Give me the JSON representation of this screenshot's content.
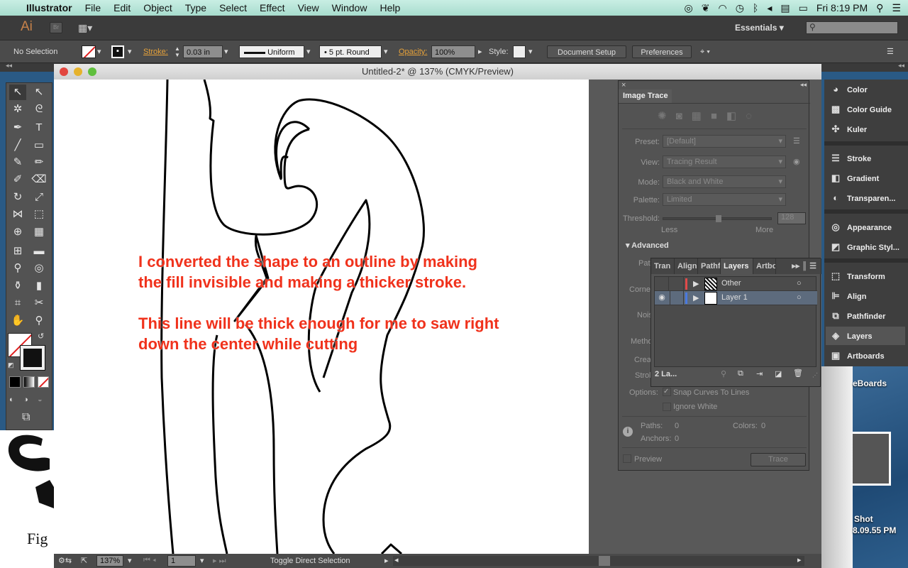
{
  "menubar": {
    "app": "Illustrator",
    "items": [
      "File",
      "Edit",
      "Object",
      "Type",
      "Select",
      "Effect",
      "View",
      "Window",
      "Help"
    ],
    "clock": "Fri 8:19 PM"
  },
  "appbar": {
    "logo": "Ai",
    "bridge": "Br",
    "workspace": "Essentials",
    "search_placeholder": ""
  },
  "control": {
    "selection": "No Selection",
    "stroke_label": "Stroke:",
    "stroke_value": "0.03 in",
    "profile": "Uniform",
    "brush": "5 pt. Round",
    "opacity_label": "Opacity:",
    "opacity_value": "100%",
    "style_label": "Style:",
    "document_setup": "Document Setup",
    "preferences": "Preferences"
  },
  "document": {
    "title": "Untitled-2* @ 137% (CMYK/Preview)",
    "zoom": "137%",
    "artboard": "1",
    "status": "Toggle Direct Selection"
  },
  "annotation": {
    "line1": "I converted the shape to an outline by making",
    "line2": "the fill invisible and making a thicker stroke.",
    "line3": "This line will be thick enough for me to saw right",
    "line4": "down the center while cutting"
  },
  "image_trace": {
    "title": "Image Trace",
    "preset_label": "Preset:",
    "preset": "[Default]",
    "view_label": "View:",
    "view": "Tracing Result",
    "mode_label": "Mode:",
    "mode": "Black and White",
    "palette_label": "Palette:",
    "palette": "Limited",
    "threshold_label": "Threshold:",
    "threshold": "128",
    "less": "Less",
    "more": "More",
    "advanced": "Advanced",
    "paths_cut": "Path",
    "corners_cut": "Corne",
    "noise_cut": "Nois",
    "method_cut": "Metho",
    "create_cut": "Crea",
    "stroke_cut": "Strol",
    "options_label": "Options:",
    "snap": "Snap Curves To Lines",
    "snap_checked": true,
    "ignore_white": "Ignore White",
    "ignore_white_checked": false,
    "paths_stat": "Paths:",
    "paths_val": "0",
    "colors_stat": "Colors:",
    "colors_val": "0",
    "anchors_stat": "Anchors:",
    "anchors_val": "0",
    "preview": "Preview",
    "trace_button": "Trace"
  },
  "layers_panel": {
    "tabs": [
      "Tran",
      "Align",
      "Pathf",
      "Layers",
      "Artbo"
    ],
    "active_tab": "Layers",
    "layers": [
      {
        "name": "Other",
        "color": "#e04a4a",
        "visible": false
      },
      {
        "name": "Layer 1",
        "color": "#4a7ae0",
        "visible": true,
        "selected": true
      }
    ],
    "count": "2 La..."
  },
  "dock": {
    "items": [
      "Color",
      "Color Guide",
      "Kuler",
      "Stroke",
      "Gradient",
      "Transparen...",
      "Appearance",
      "Graphic Styl...",
      "Transform",
      "Align",
      "Pathfinder",
      "Layers",
      "Artboards"
    ]
  },
  "desktop": {
    "label1": "eBoards",
    "label2": "Shot",
    "label3": "8.09.55 PM",
    "fig_text": "Fig"
  }
}
